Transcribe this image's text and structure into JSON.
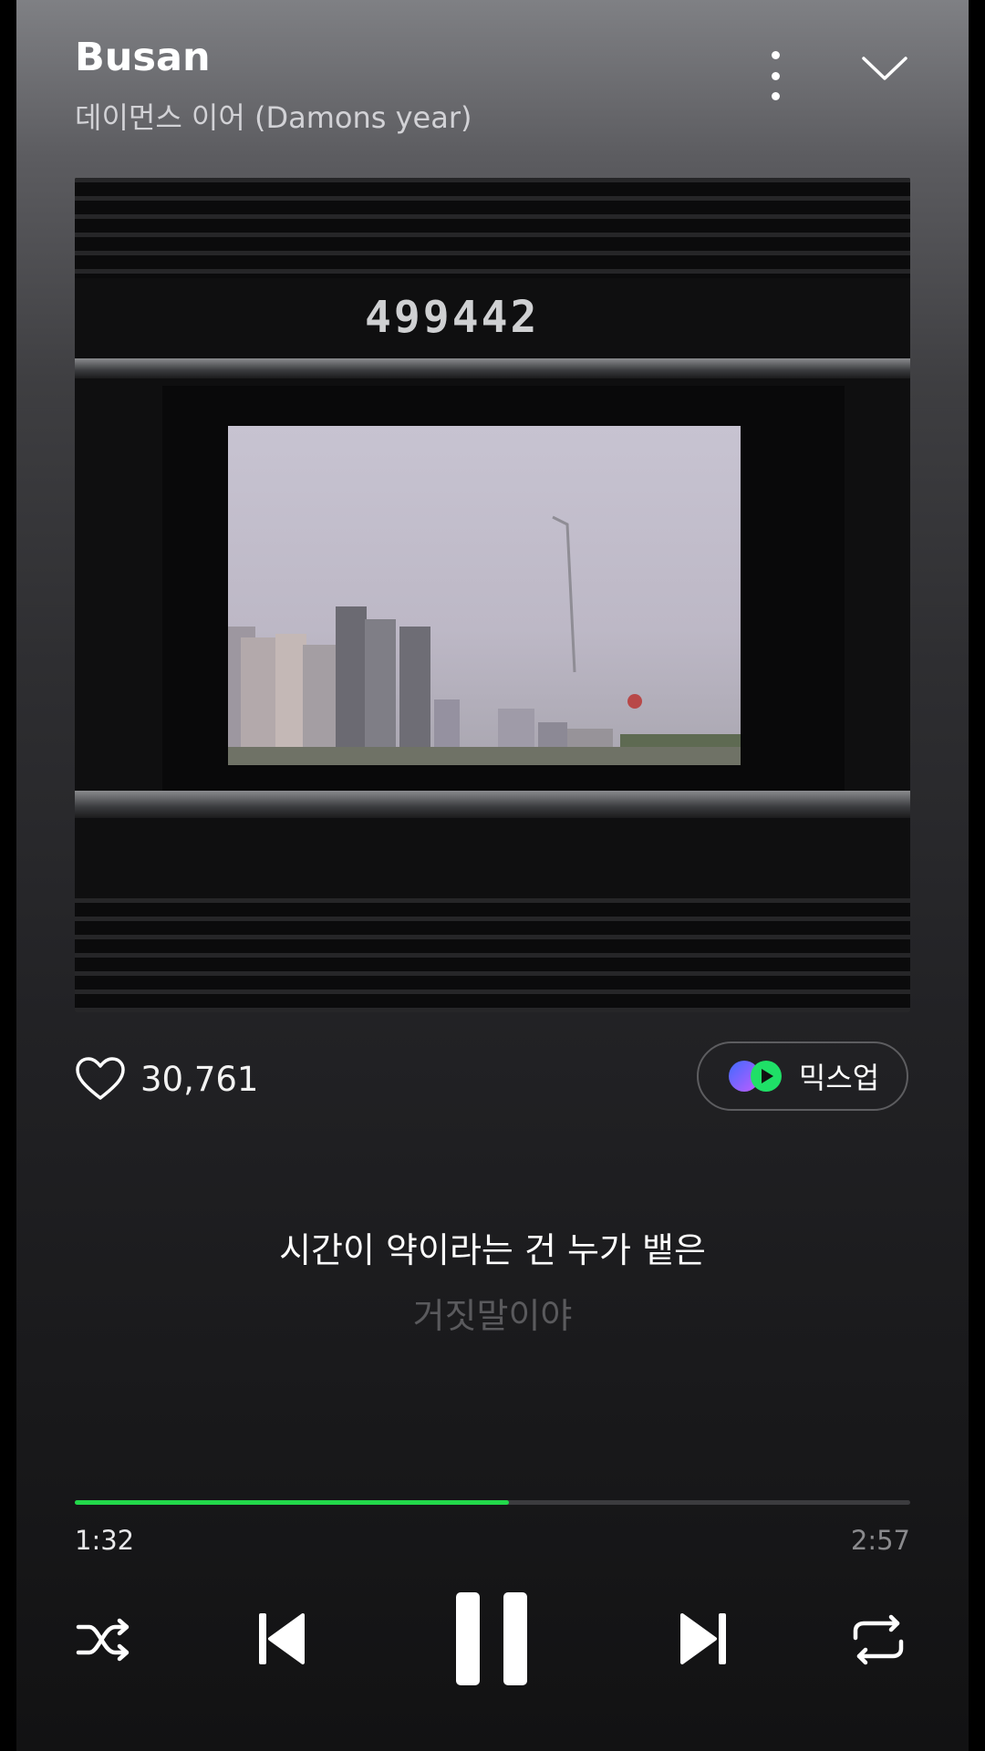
{
  "header": {
    "title": "Busan",
    "artist": "데이먼스 이어 (Damons year)"
  },
  "album_art": {
    "serial": "499442"
  },
  "likes": {
    "count": "30,761"
  },
  "mixup": {
    "label": "믹스업"
  },
  "lyrics": {
    "current": "시간이 약이라는 건 누가 뱉은",
    "next": "거짓말이야"
  },
  "progress": {
    "current": "1:32",
    "total": "2:57",
    "fraction": 0.52
  },
  "controls": [
    "shuffle-icon",
    "previous-icon",
    "pause-icon",
    "next-icon",
    "repeat-icon"
  ],
  "colors": {
    "accent": "#22d84a",
    "background_top": "#7f8084",
    "background_bottom": "#121213"
  }
}
